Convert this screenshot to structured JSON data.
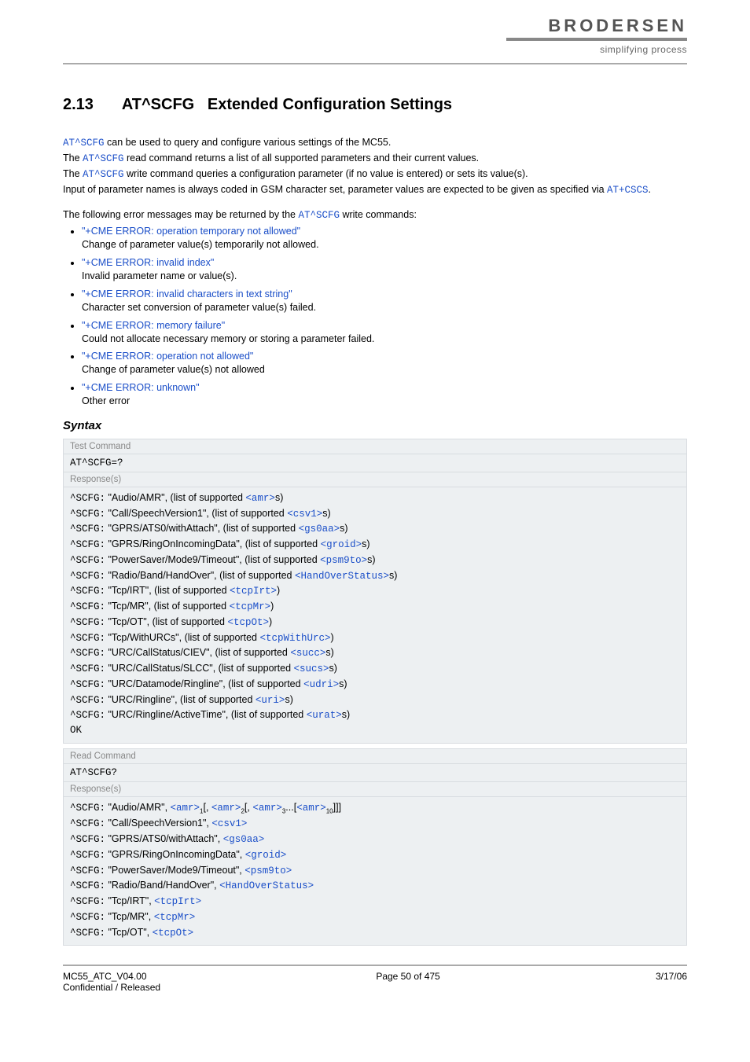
{
  "header": {
    "logo": "BRODERSEN",
    "tagline": "simplifying process"
  },
  "section": {
    "number": "2.13",
    "title_cmd": "AT^SCFG",
    "title_rest": "Extended Configuration Settings"
  },
  "intro": {
    "l1a": "AT^SCFG",
    "l1b": " can be used to query and configure various settings of the MC55.",
    "l2a": "The ",
    "l2b": "AT^SCFG",
    "l2c": " read command returns a list of all supported parameters and their current values.",
    "l3a": "The ",
    "l3b": "AT^SCFG",
    "l3c": " write command queries a configuration parameter (if no value is entered) or sets its value(s).",
    "l4": "Input of parameter names is always coded in GSM character set, parameter values are expected to be given as specified via ",
    "l4b": "AT+CSCS",
    "l4c": "."
  },
  "errintro_a": "The following error messages may be returned by the ",
  "errintro_b": "AT^SCFG",
  "errintro_c": " write commands:",
  "errors": [
    {
      "msg": "\"+CME ERROR: operation temporary not allowed\"",
      "desc": "Change of parameter value(s) temporarily not allowed."
    },
    {
      "msg": "\"+CME ERROR: invalid index\"",
      "desc": "Invalid parameter name or value(s)."
    },
    {
      "msg": "\"+CME ERROR: invalid characters in text string\"",
      "desc": "Character set conversion of parameter value(s) failed."
    },
    {
      "msg": "\"+CME ERROR: memory failure\"",
      "desc": "Could not allocate necessary memory or storing a parameter failed."
    },
    {
      "msg": "\"+CME ERROR: operation not allowed\"",
      "desc": "Change of parameter value(s) not allowed"
    },
    {
      "msg": "\"+CME ERROR: unknown\"",
      "desc": "Other error"
    }
  ],
  "syntax_label": "Syntax",
  "test": {
    "header": "Test Command",
    "cmd": "AT^SCFG=?",
    "resp_label": "Response(s)",
    "lines": [
      {
        "pre": "^SCFG:",
        "t1": " \"Audio/AMR\", (list of supported ",
        "p": "<amr>",
        "t2": "s)"
      },
      {
        "pre": "^SCFG:",
        "t1": " \"Call/SpeechVersion1\", (list of supported ",
        "p": "<csv1>",
        "t2": "s)"
      },
      {
        "pre": "^SCFG:",
        "t1": " \"GPRS/ATS0/withAttach\", (list of supported ",
        "p": "<gs0aa>",
        "t2": "s)"
      },
      {
        "pre": "^SCFG:",
        "t1": " \"GPRS/RingOnIncomingData\", (list of supported ",
        "p": "<groid>",
        "t2": "s)"
      },
      {
        "pre": "^SCFG:",
        "t1": " \"PowerSaver/Mode9/Timeout\", (list of supported ",
        "p": "<psm9to>",
        "t2": "s)"
      },
      {
        "pre": "^SCFG:",
        "t1": " \"Radio/Band/HandOver\", (list of supported ",
        "p": "<HandOverStatus>",
        "t2": "s)"
      },
      {
        "pre": "^SCFG:",
        "t1": " \"Tcp/IRT\", (list of supported ",
        "p": "<tcpIrt>",
        "t2": ")"
      },
      {
        "pre": "^SCFG:",
        "t1": " \"Tcp/MR\", (list of supported ",
        "p": "<tcpMr>",
        "t2": ")"
      },
      {
        "pre": "^SCFG:",
        "t1": " \"Tcp/OT\", (list of supported ",
        "p": "<tcpOt>",
        "t2": ")"
      },
      {
        "pre": "^SCFG:",
        "t1": " \"Tcp/WithURCs\", (list of supported ",
        "p": "<tcpWithUrc>",
        "t2": ")"
      },
      {
        "pre": "^SCFG:",
        "t1": " \"URC/CallStatus/CIEV\", (list of supported ",
        "p": "<succ>",
        "t2": "s)"
      },
      {
        "pre": "^SCFG:",
        "t1": " \"URC/CallStatus/SLCC\", (list of supported ",
        "p": "<sucs>",
        "t2": "s)"
      },
      {
        "pre": "^SCFG:",
        "t1": " \"URC/Datamode/Ringline\", (list of supported ",
        "p": "<udri>",
        "t2": "s)"
      },
      {
        "pre": "^SCFG:",
        "t1": " \"URC/Ringline\", (list of supported ",
        "p": "<uri>",
        "t2": "s)"
      },
      {
        "pre": "^SCFG:",
        "t1": " \"URC/Ringline/ActiveTime\", (list of supported ",
        "p": "<urat>",
        "t2": "s)"
      }
    ],
    "ok": "OK"
  },
  "read": {
    "header": "Read Command",
    "cmd": "AT^SCFG?",
    "resp_label": "Response(s)",
    "amr_line": {
      "pre": "^SCFG:",
      "t1": " \"Audio/AMR\", ",
      "p": "<amr>",
      "s1": "1",
      "c1": "[, ",
      "s2": "2",
      "c2": "[, ",
      "s3": "3",
      "c3": "...[",
      "s10": "10",
      "c4": "]]]"
    },
    "lines": [
      {
        "pre": "^SCFG:",
        "t1": " \"Call/SpeechVersion1\", ",
        "p": "<csv1>"
      },
      {
        "pre": "^SCFG:",
        "t1": " \"GPRS/ATS0/withAttach\", ",
        "p": "<gs0aa>"
      },
      {
        "pre": "^SCFG:",
        "t1": " \"GPRS/RingOnIncomingData\", ",
        "p": "<groid>"
      },
      {
        "pre": "^SCFG:",
        "t1": " \"PowerSaver/Mode9/Timeout\", ",
        "p": "<psm9to>"
      },
      {
        "pre": "^SCFG:",
        "t1": " \"Radio/Band/HandOver\", ",
        "p": "<HandOverStatus>"
      },
      {
        "pre": "^SCFG:",
        "t1": " \"Tcp/IRT\", ",
        "p": "<tcpIrt>"
      },
      {
        "pre": "^SCFG:",
        "t1": " \"Tcp/MR\", ",
        "p": "<tcpMr>"
      },
      {
        "pre": "^SCFG:",
        "t1": " \"Tcp/OT\", ",
        "p": "<tcpOt>"
      }
    ]
  },
  "footer": {
    "left1": "MC55_ATC_V04.00",
    "left2": "Confidential / Released",
    "center": "Page 50 of 475",
    "right": "3/17/06"
  }
}
